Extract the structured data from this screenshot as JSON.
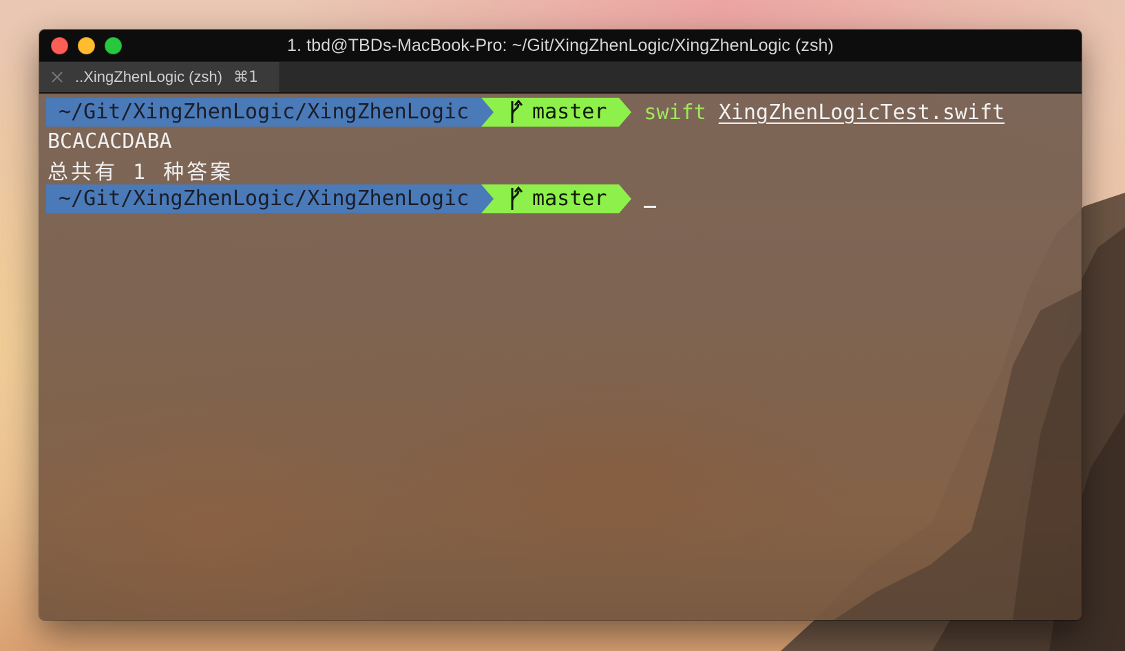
{
  "window": {
    "title": "1. tbd@TBDs-MacBook-Pro: ~/Git/XingZhenLogic/XingZhenLogic (zsh)"
  },
  "tabs": [
    {
      "label": "..XingZhenLogic (zsh)",
      "shortcut": "⌘1"
    }
  ],
  "terminal": {
    "lines": [
      {
        "type": "prompt",
        "path": "~/Git/XingZhenLogic/XingZhenLogic",
        "branch": "master",
        "command": "swift",
        "argument": "XingZhenLogicTest.swift"
      },
      {
        "type": "output",
        "text": "BCACACDABA"
      },
      {
        "type": "output",
        "text": "总共有 1 种答案"
      },
      {
        "type": "prompt",
        "path": "~/Git/XingZhenLogic/XingZhenLogic",
        "branch": "master",
        "command": "",
        "argument": ""
      }
    ]
  },
  "colors": {
    "path_segment": "#4a7ab8",
    "git_segment": "#8ef04a",
    "command_text": "#9ee85a",
    "close_button": "#fd5f57",
    "minimize_button": "#febc2e",
    "zoom_button": "#27c840"
  },
  "icons": {
    "branch": "git-branch-icon",
    "tab_close": "close-icon"
  }
}
